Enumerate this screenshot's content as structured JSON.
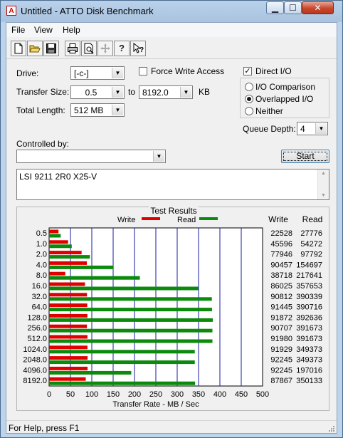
{
  "window": {
    "title": "Untitled - ATTO Disk Benchmark",
    "minimize_glyph": "▁",
    "maximize_glyph": "☐",
    "close_glyph": "✕"
  },
  "menu": {
    "items": [
      "File",
      "View",
      "Help"
    ]
  },
  "toolbar": {
    "buttons": [
      {
        "name": "new-document-icon"
      },
      {
        "name": "open-folder-icon"
      },
      {
        "name": "save-disk-icon"
      },
      {
        "name": "print-icon"
      },
      {
        "name": "print-preview-icon"
      },
      {
        "name": "move-crosshair-icon"
      },
      {
        "name": "help-question-icon"
      },
      {
        "name": "context-help-icon"
      }
    ]
  },
  "settings": {
    "drive_label": "Drive:",
    "drive_value": "[-c-]",
    "force_write_label": "Force Write Access",
    "force_write_checked": false,
    "direct_io_label": "Direct I/O",
    "direct_io_checked": true,
    "transfer_size_label": "Transfer Size:",
    "transfer_from": "0.5",
    "to_label": "to",
    "transfer_to": "8192.0",
    "kb_label": "KB",
    "total_length_label": "Total Length:",
    "total_length_value": "512 MB",
    "radio_io_comparison": "I/O Comparison",
    "radio_overlapped": "Overlapped I/O",
    "radio_neither": "Neither",
    "radio_selected": "Overlapped I/O",
    "queue_depth_label": "Queue Depth:",
    "queue_depth_value": "4",
    "controlled_by_label": "Controlled by:",
    "controlled_by_value": "",
    "start_label": "Start",
    "description_text": "LSI 9211 2R0 X25-V"
  },
  "status": {
    "text": "For Help, press F1"
  },
  "colors": {
    "write": "#e00000",
    "read": "#0b8a0b",
    "grid": "#1a1aa0"
  },
  "chart_data": {
    "type": "bar",
    "title": "Test Results",
    "xlabel": "Transfer Rate - MB / Sec",
    "ylabel": "",
    "xlim": [
      0,
      500
    ],
    "xticks": [
      0,
      50,
      100,
      150,
      200,
      250,
      300,
      350,
      400,
      450,
      500
    ],
    "legend_position": "top",
    "column_headers": [
      "Write",
      "Read"
    ],
    "categories": [
      "0.5",
      "1.0",
      "2.0",
      "4.0",
      "8.0",
      "16.0",
      "32.0",
      "64.0",
      "128.0",
      "256.0",
      "512.0",
      "1024.0",
      "2048.0",
      "4096.0",
      "8192.0"
    ],
    "series": [
      {
        "name": "Write",
        "values": [
          22528,
          45596,
          77946,
          90457,
          38718,
          86025,
          90812,
          91445,
          91872,
          90707,
          91980,
          91929,
          92245,
          92245,
          87867
        ]
      },
      {
        "name": "Read",
        "values": [
          27776,
          54272,
          97792,
          154697,
          217641,
          357653,
          390339,
          390716,
          392636,
          391673,
          391673,
          349373,
          349373,
          197016,
          350133
        ]
      }
    ],
    "value_unit_note": "values are KB/sec as printed"
  }
}
